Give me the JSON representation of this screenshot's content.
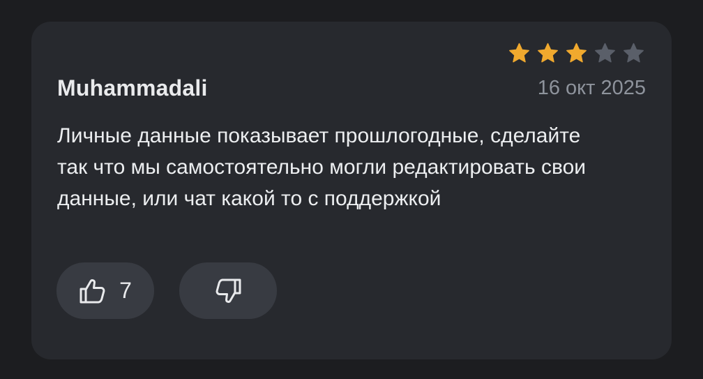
{
  "review": {
    "author": "Muhammadali",
    "date": "16 окт 2025",
    "rating": 3,
    "max_rating": 5,
    "text": "Личные данные показывает прошлогодные, сделайте так что мы самостоятельно могли редактировать свои данные, или чат какой то с поддержкой",
    "likes": "7"
  },
  "colors": {
    "background": "#1c1d20",
    "card": "#27292e",
    "button": "#383b42",
    "star_filled": "#f0a92e",
    "star_empty": "#5a5f69",
    "date_text": "#8e939c"
  },
  "icons": {
    "like": "thumbs-up-icon",
    "dislike": "thumbs-down-icon",
    "star": "star-icon"
  }
}
